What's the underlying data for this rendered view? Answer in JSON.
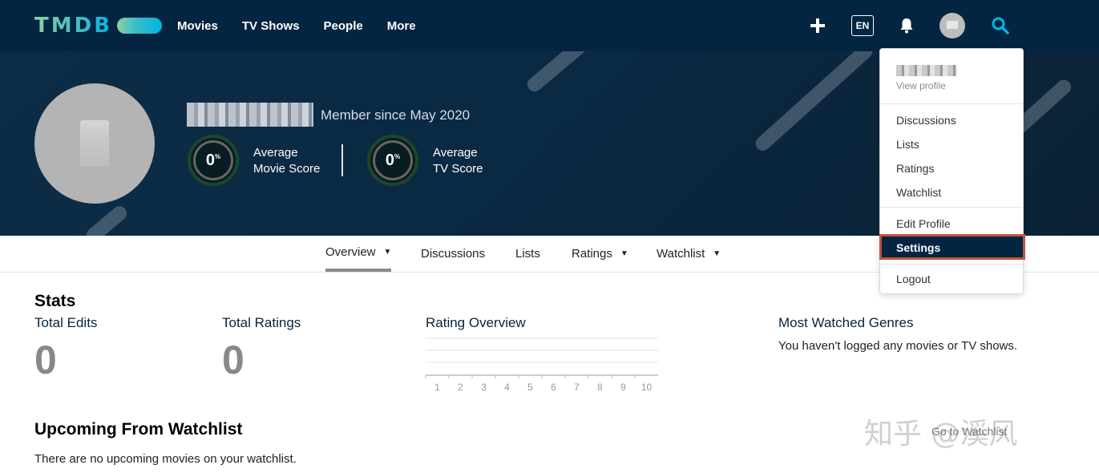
{
  "nav": {
    "logo": "TMDB",
    "links": [
      "Movies",
      "TV Shows",
      "People",
      "More"
    ],
    "lang": "EN",
    "icons": [
      "plus-icon",
      "bell-icon",
      "avatar",
      "search-icon"
    ]
  },
  "profile": {
    "member_since": "Member since May 2020",
    "movie_score": "0",
    "movie_score_label_1": "Average",
    "movie_score_label_2": "Movie Score",
    "tv_score": "0",
    "tv_score_label_1": "Average",
    "tv_score_label_2": "TV Score",
    "percent_sign": "%"
  },
  "tabs": [
    {
      "label": "Overview",
      "caret": "▼"
    },
    {
      "label": "Discussions"
    },
    {
      "label": "Lists"
    },
    {
      "label": "Ratings",
      "caret": "▼"
    },
    {
      "label": "Watchlist",
      "caret": "▼"
    }
  ],
  "stats": {
    "title": "Stats",
    "total_edits_label": "Total Edits",
    "total_edits_value": "0",
    "total_ratings_label": "Total Ratings",
    "total_ratings_value": "0",
    "rating_overview_title": "Rating Overview",
    "rating_ticks": [
      "1",
      "2",
      "3",
      "4",
      "5",
      "6",
      "7",
      "8",
      "9",
      "10"
    ],
    "genres_title": "Most Watched Genres",
    "genres_empty": "You haven't logged any movies or TV shows."
  },
  "upcoming": {
    "title": "Upcoming From Watchlist",
    "empty": "There are no upcoming movies on your watchlist.",
    "goto": "Go to Watchlist"
  },
  "dropdown": {
    "view_profile": "View profile",
    "items_group1": [
      "Discussions",
      "Lists",
      "Ratings",
      "Watchlist"
    ],
    "edit_profile": "Edit Profile",
    "settings": "Settings",
    "logout": "Logout"
  },
  "watermark": "知乎 @溪风",
  "colors": {
    "nav_bg": "#032541",
    "highlight_border": "#c0543a"
  }
}
